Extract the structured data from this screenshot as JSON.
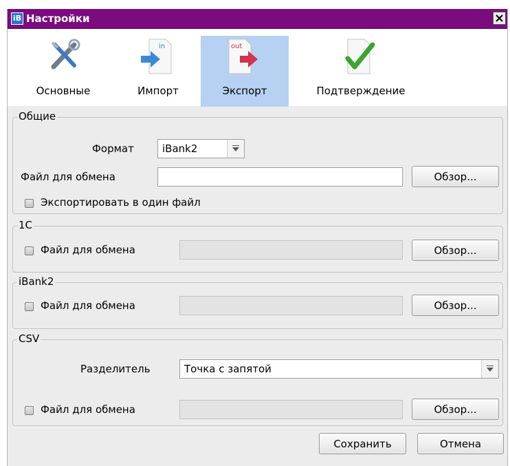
{
  "window": {
    "title": "Настройки"
  },
  "toolbar": {
    "items": [
      {
        "label": "Основные",
        "icon": "tools-icon",
        "active": false
      },
      {
        "label": "Импорт",
        "icon": "import-icon",
        "icon_text": "in",
        "active": false
      },
      {
        "label": "Экспорт",
        "icon": "export-icon",
        "icon_text": "out",
        "active": true
      },
      {
        "label": "Подтверждение",
        "icon": "checkmark-icon",
        "active": false
      }
    ]
  },
  "general": {
    "title": "Общие",
    "format_label": "Формат",
    "format_value": "iBank2",
    "file_label": "Файл для обмена",
    "file_value": "",
    "browse_label": "Обзор...",
    "single_file_label": "Экспортировать в один файл",
    "single_file_checked": false
  },
  "onec": {
    "title": "1С",
    "file_label": "Файл для обмена",
    "file_value": "",
    "browse_label": "Обзор...",
    "checked": false
  },
  "ibank2": {
    "title": "iBank2",
    "file_label": "Файл для обмена",
    "file_value": "",
    "browse_label": "Обзор...",
    "checked": false
  },
  "csv": {
    "title": "CSV",
    "separator_label": "Разделитель",
    "separator_value": "Точка с запятой",
    "file_label": "Файл для обмена",
    "file_value": "",
    "browse_label": "Обзор...",
    "checked": false
  },
  "footer": {
    "save_label": "Сохранить",
    "cancel_label": "Отмена"
  },
  "colors": {
    "titlebar": "#7b0b7e",
    "active_tab": "#b6d1f2",
    "panel": "#ececec"
  }
}
